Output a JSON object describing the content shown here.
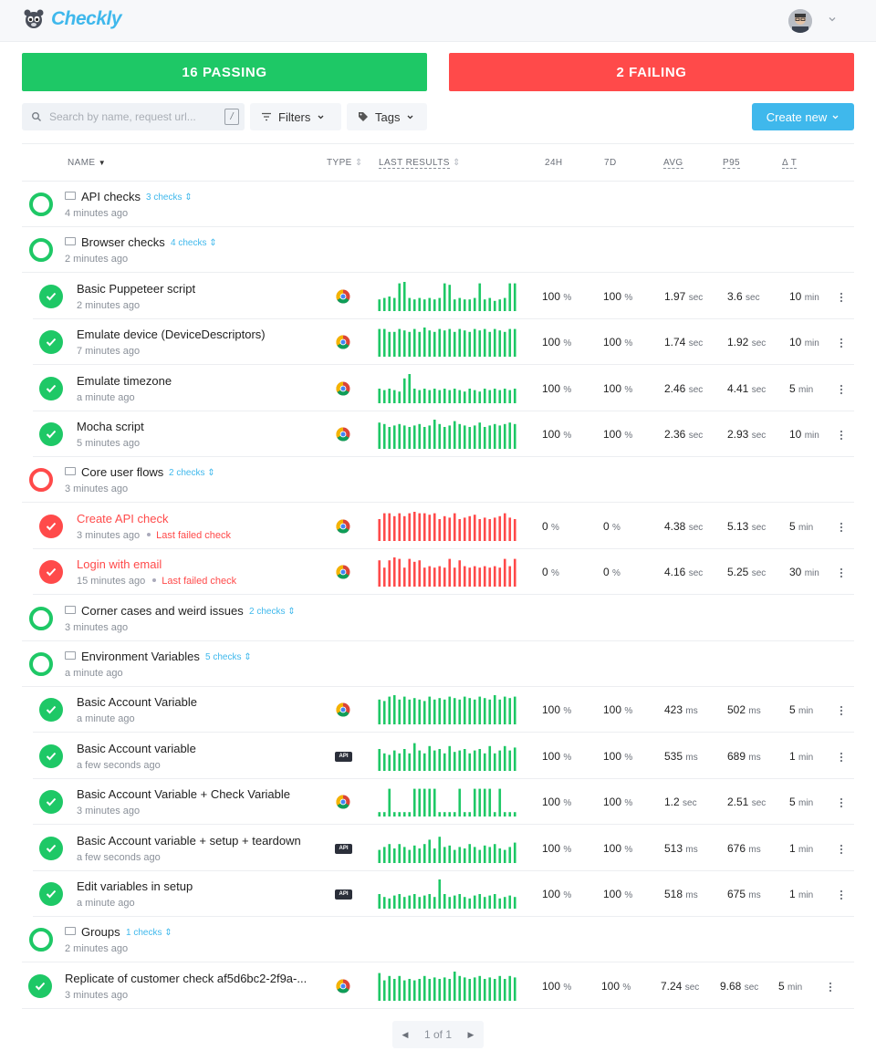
{
  "app": {
    "name": "Checkly"
  },
  "summary": {
    "passing_label": "16 PASSING",
    "failing_label": "2 FAILING"
  },
  "toolbar": {
    "search_placeholder": "Search by name, request url...",
    "search_shortcut": "/",
    "filters_label": "Filters",
    "tags_label": "Tags",
    "create_label": "Create new"
  },
  "columns": {
    "name": "NAME",
    "type": "TYPE",
    "last_results": "LAST RESULTS",
    "h24": "24H",
    "d7": "7D",
    "avg": "AVG",
    "p95": "P95",
    "dt": "Δ T"
  },
  "colors": {
    "pass": "#1ec866",
    "fail": "#ff4a4a",
    "accent": "#3fb8ec"
  },
  "rows": [
    {
      "kind": "group",
      "status": "pass",
      "name": "API checks",
      "count": "3 checks",
      "ago": "4 minutes ago"
    },
    {
      "kind": "group",
      "status": "pass",
      "name": "Browser checks",
      "count": "4 checks",
      "ago": "2 minutes ago"
    },
    {
      "kind": "check",
      "status": "pass",
      "type": "chrome-icon",
      "name": "Basic Puppeteer script",
      "ago": "2 minutes ago",
      "r24": "100",
      "r24u": "%",
      "r7": "100",
      "r7u": "%",
      "avg": "1.97",
      "avgu": "sec",
      "p95": "3.6",
      "p95u": "sec",
      "dt": "10",
      "dtu": "min",
      "results": [
        0.4,
        0.45,
        0.5,
        0.45,
        0.95,
        1,
        0.45,
        0.4,
        0.45,
        0.4,
        0.45,
        0.4,
        0.45,
        0.95,
        0.9,
        0.4,
        0.45,
        0.4,
        0.4,
        0.45,
        0.95,
        0.4,
        0.45,
        0.35,
        0.4,
        0.45,
        0.95,
        0.95
      ]
    },
    {
      "kind": "check",
      "status": "pass",
      "type": "chrome-icon",
      "name": "Emulate device (DeviceDescriptors)",
      "ago": "7 minutes ago",
      "r24": "100",
      "r24u": "%",
      "r7": "100",
      "r7u": "%",
      "avg": "1.74",
      "avgu": "sec",
      "p95": "1.92",
      "p95u": "sec",
      "dt": "10",
      "dtu": "min",
      "results": [
        0.95,
        0.95,
        0.85,
        0.85,
        0.95,
        0.9,
        0.85,
        0.95,
        0.85,
        1,
        0.9,
        0.85,
        0.95,
        0.9,
        0.95,
        0.85,
        0.95,
        0.9,
        0.85,
        0.95,
        0.9,
        0.95,
        0.85,
        0.95,
        0.9,
        0.85,
        0.95,
        0.95
      ]
    },
    {
      "kind": "check",
      "status": "pass",
      "type": "chrome-icon",
      "name": "Emulate timezone",
      "ago": "a minute ago",
      "r24": "100",
      "r24u": "%",
      "r7": "100",
      "r7u": "%",
      "avg": "2.46",
      "avgu": "sec",
      "p95": "4.41",
      "p95u": "sec",
      "dt": "5",
      "dtu": "min",
      "results": [
        0.5,
        0.45,
        0.5,
        0.45,
        0.4,
        0.85,
        1,
        0.5,
        0.45,
        0.5,
        0.45,
        0.5,
        0.45,
        0.5,
        0.45,
        0.5,
        0.45,
        0.4,
        0.5,
        0.45,
        0.4,
        0.5,
        0.45,
        0.5,
        0.45,
        0.5,
        0.45,
        0.5
      ]
    },
    {
      "kind": "check",
      "status": "pass",
      "type": "chrome-icon",
      "name": "Mocha script",
      "ago": "5 minutes ago",
      "r24": "100",
      "r24u": "%",
      "r7": "100",
      "r7u": "%",
      "avg": "2.36",
      "avgu": "sec",
      "p95": "2.93",
      "p95u": "sec",
      "dt": "10",
      "dtu": "min",
      "results": [
        0.9,
        0.85,
        0.75,
        0.8,
        0.85,
        0.8,
        0.75,
        0.8,
        0.85,
        0.75,
        0.8,
        1,
        0.85,
        0.75,
        0.8,
        0.95,
        0.85,
        0.8,
        0.75,
        0.8,
        0.9,
        0.75,
        0.8,
        0.85,
        0.8,
        0.85,
        0.9,
        0.85
      ]
    },
    {
      "kind": "group",
      "status": "fail",
      "name": "Core user flows",
      "count": "2 checks",
      "ago": "3 minutes ago"
    },
    {
      "kind": "check",
      "status": "fail",
      "type": "chrome-icon",
      "name": "Create API check",
      "ago": "3 minutes ago",
      "extra": "Last failed check",
      "r24": "0",
      "r24u": "%",
      "r7": "0",
      "r7u": "%",
      "avg": "4.38",
      "avgu": "sec",
      "p95": "5.13",
      "p95u": "sec",
      "dt": "5",
      "dtu": "min",
      "results": [
        0.75,
        0.95,
        0.95,
        0.85,
        0.95,
        0.85,
        0.95,
        1,
        0.95,
        0.95,
        0.9,
        0.95,
        0.75,
        0.85,
        0.8,
        0.95,
        0.75,
        0.8,
        0.85,
        0.9,
        0.75,
        0.8,
        0.75,
        0.8,
        0.85,
        0.95,
        0.8,
        0.75
      ]
    },
    {
      "kind": "check",
      "status": "fail",
      "type": "chrome-icon",
      "name": "Login with email",
      "ago": "15 minutes ago",
      "extra": "Last failed check",
      "r24": "0",
      "r24u": "%",
      "r7": "0",
      "r7u": "%",
      "avg": "4.16",
      "avgu": "sec",
      "p95": "5.25",
      "p95u": "sec",
      "dt": "30",
      "dtu": "min",
      "results": [
        0.9,
        0.65,
        0.9,
        1,
        0.95,
        0.65,
        0.95,
        0.85,
        0.9,
        0.65,
        0.7,
        0.65,
        0.7,
        0.65,
        0.95,
        0.65,
        0.9,
        0.7,
        0.65,
        0.7,
        0.65,
        0.7,
        0.65,
        0.7,
        0.65,
        0.95,
        0.7,
        0.95
      ]
    },
    {
      "kind": "group",
      "status": "pass",
      "name": "Corner cases and weird issues",
      "count": "2 checks",
      "ago": "3 minutes ago"
    },
    {
      "kind": "group",
      "status": "pass",
      "name": "Environment Variables",
      "count": "5 checks",
      "ago": "a minute ago"
    },
    {
      "kind": "check",
      "status": "pass",
      "type": "chrome-icon",
      "name": "Basic Account Variable",
      "ago": "a minute ago",
      "r24": "100",
      "r24u": "%",
      "r7": "100",
      "r7u": "%",
      "avg": "423",
      "avgu": "ms",
      "p95": "502",
      "p95u": "ms",
      "dt": "5",
      "dtu": "min",
      "results": [
        0.85,
        0.8,
        0.95,
        1,
        0.85,
        0.95,
        0.85,
        0.9,
        0.85,
        0.8,
        0.95,
        0.85,
        0.9,
        0.85,
        0.95,
        0.9,
        0.85,
        0.95,
        0.9,
        0.85,
        0.95,
        0.9,
        0.85,
        1,
        0.85,
        0.95,
        0.9,
        0.95
      ]
    },
    {
      "kind": "check",
      "status": "pass",
      "type": "api-icon",
      "name": "Basic Account variable",
      "ago": "a few seconds ago",
      "r24": "100",
      "r24u": "%",
      "r7": "100",
      "r7u": "%",
      "avg": "535",
      "avgu": "ms",
      "p95": "689",
      "p95u": "ms",
      "dt": "1",
      "dtu": "min",
      "results": [
        0.75,
        0.6,
        0.55,
        0.7,
        0.6,
        0.75,
        0.6,
        0.95,
        0.7,
        0.6,
        0.85,
        0.7,
        0.75,
        0.6,
        0.85,
        0.65,
        0.7,
        0.75,
        0.6,
        0.7,
        0.75,
        0.6,
        0.85,
        0.6,
        0.7,
        0.85,
        0.7,
        0.8
      ]
    },
    {
      "kind": "check",
      "status": "pass",
      "type": "chrome-icon",
      "name": "Basic Account Variable + Check Variable",
      "ago": "3 minutes ago",
      "r24": "100",
      "r24u": "%",
      "r7": "100",
      "r7u": "%",
      "avg": "1.2",
      "avgu": "sec",
      "p95": "2.51",
      "p95u": "sec",
      "dt": "5",
      "dtu": "min",
      "results": [
        0.15,
        0.15,
        0.95,
        0.15,
        0.15,
        0.15,
        0.15,
        0.95,
        0.95,
        0.95,
        0.95,
        0.95,
        0.15,
        0.15,
        0.15,
        0.15,
        0.95,
        0.15,
        0.15,
        0.95,
        0.95,
        0.95,
        0.95,
        0.15,
        0.95,
        0.15,
        0.15,
        0.15
      ]
    },
    {
      "kind": "check",
      "status": "pass",
      "type": "api-icon",
      "name": "Basic Account variable + setup + teardown",
      "ago": "a few seconds ago",
      "r24": "100",
      "r24u": "%",
      "r7": "100",
      "r7u": "%",
      "avg": "513",
      "avgu": "ms",
      "p95": "676",
      "p95u": "ms",
      "dt": "1",
      "dtu": "min",
      "results": [
        0.45,
        0.55,
        0.65,
        0.5,
        0.65,
        0.55,
        0.45,
        0.6,
        0.5,
        0.65,
        0.8,
        0.5,
        0.9,
        0.55,
        0.6,
        0.45,
        0.55,
        0.5,
        0.65,
        0.55,
        0.45,
        0.6,
        0.55,
        0.65,
        0.5,
        0.45,
        0.55,
        0.7
      ]
    },
    {
      "kind": "check",
      "status": "pass",
      "type": "api-icon",
      "name": "Edit variables in setup",
      "ago": "a minute ago",
      "r24": "100",
      "r24u": "%",
      "r7": "100",
      "r7u": "%",
      "avg": "518",
      "avgu": "ms",
      "p95": "675",
      "p95u": "ms",
      "dt": "1",
      "dtu": "min",
      "results": [
        0.5,
        0.4,
        0.35,
        0.45,
        0.5,
        0.4,
        0.45,
        0.5,
        0.4,
        0.45,
        0.5,
        0.4,
        1,
        0.5,
        0.4,
        0.45,
        0.5,
        0.4,
        0.35,
        0.45,
        0.5,
        0.4,
        0.45,
        0.5,
        0.35,
        0.4,
        0.45,
        0.4
      ]
    },
    {
      "kind": "group",
      "status": "pass",
      "name": "Groups",
      "count": "1 checks",
      "ago": "2 minutes ago"
    },
    {
      "kind": "root",
      "status": "pass",
      "type": "chrome-icon",
      "name": "Replicate of customer check af5d6bc2-2f9a-...",
      "ago": "3 minutes ago",
      "r24": "100",
      "r24u": "%",
      "r7": "100",
      "r7u": "%",
      "avg": "7.24",
      "avgu": "sec",
      "p95": "9.68",
      "p95u": "sec",
      "dt": "5",
      "dtu": "min",
      "results": [
        0.95,
        0.7,
        0.85,
        0.75,
        0.85,
        0.7,
        0.75,
        0.7,
        0.75,
        0.85,
        0.75,
        0.8,
        0.75,
        0.8,
        0.75,
        1,
        0.85,
        0.8,
        0.75,
        0.8,
        0.85,
        0.75,
        0.8,
        0.75,
        0.85,
        0.75,
        0.85,
        0.8
      ]
    }
  ],
  "pagination": {
    "label": "1 of 1"
  }
}
